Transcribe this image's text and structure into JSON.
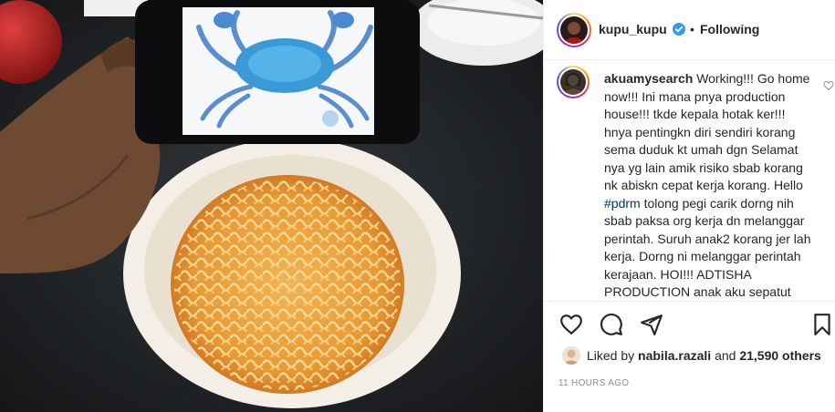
{
  "post": {
    "username": "kupu_kupu",
    "verified": true,
    "separator": "•",
    "follow_status": "Following"
  },
  "caption": {
    "username": "akuamysearch",
    "text_before": "Working!!! Go home now!!! Ini mana pnya production house!!! tkde kepala hotak ker!!! hnya pentingkn diri sendiri korang sema duduk kt umah dgn Selamat nya yg lain amik risiko sbab korang nk abiskn cepat kerja korang. Hello ",
    "hashtag": "#pdrm",
    "text_after": " tolong pegi carik dorng nih sbab paksa org kerja dn melanggar perintah. Suruh anak2 korang jer lah kerja. Dorng ni melanggar perintah kerajaan. HOI!!! ADTISHA PRODUCTION anak aku sepatut"
  },
  "actions": {
    "icons": [
      "heart-icon",
      "comment-icon",
      "share-icon",
      "bookmark-icon"
    ]
  },
  "likes": {
    "prefix": "Liked by",
    "user": "nabila.razali",
    "conjunction": "and",
    "count": "21,590 others"
  },
  "timestamp": "11 HOURS AGO",
  "colors": {
    "verified": "#3897f0",
    "hashtag": "#00376b",
    "text": "#262626",
    "muted": "#8e8e8e"
  }
}
